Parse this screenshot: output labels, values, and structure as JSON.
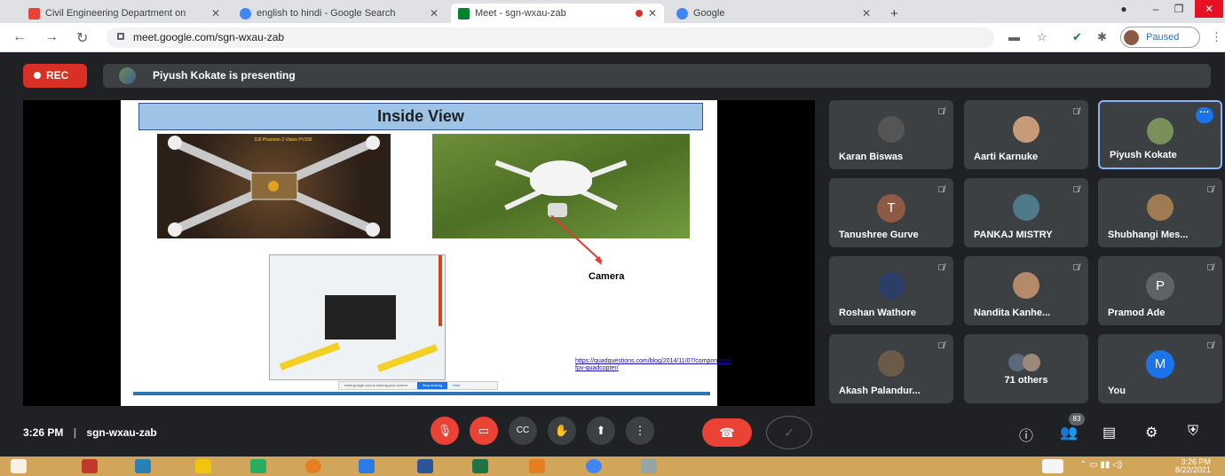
{
  "browser": {
    "tabs": [
      {
        "title": "Civil Engineering Department on",
        "favicon_color": "#ea4335"
      },
      {
        "title": "english to hindi - Google Search",
        "favicon_color": "#4285f4"
      },
      {
        "title": "Meet - sgn-wxau-zab",
        "favicon_color": "#00832d"
      },
      {
        "title": "Google",
        "favicon_color": "#4285f4"
      }
    ],
    "new_tab": "+",
    "url": "meet.google.com/sgn-wxau-zab",
    "profile_status": "Paused"
  },
  "meet": {
    "rec_label": "REC",
    "presenting_text": "Piyush Kokate is presenting",
    "slide": {
      "title": "Inside View",
      "camera_label": "Camera",
      "link": "https://quadquestions.com/blog/2014/11/07/components-fpv-quadcopter/",
      "img1_caption": "DJI Phantom 2 Vision PV330",
      "share_text": "meet.google.com is sharing your screen",
      "stop_sharing": "Stop sharing",
      "hide": "Hide"
    },
    "participants": [
      {
        "name": "Karan Biswas",
        "avatar_color": "#555"
      },
      {
        "name": "Aarti Karnuke",
        "avatar_color": "#c79a78"
      },
      {
        "name": "Piyush Kokate",
        "avatar_color": "#7a8f5a"
      },
      {
        "name": "Tanushree Gurve",
        "letter": "T",
        "avatar_color": "#8d5b45"
      },
      {
        "name": "PANKAJ MISTRY",
        "avatar_color": "#4f7a8a"
      },
      {
        "name": "Shubhangi Mes...",
        "avatar_color": "#a07a50"
      },
      {
        "name": "Roshan Wathore",
        "avatar_color": "#2b3f66"
      },
      {
        "name": "Nandita Kanhe...",
        "avatar_color": "#b48a6a"
      },
      {
        "name": "Pramod Ade",
        "letter": "P",
        "avatar_color": "#5f6368"
      },
      {
        "name": "Akash Palandur...",
        "avatar_color": "#6a5a48"
      },
      {
        "name": "71 others"
      },
      {
        "name": "You",
        "letter": "M",
        "avatar_color": "#1a73e8"
      }
    ],
    "time": "3:26 PM",
    "meeting_code": "sgn-wxau-zab",
    "people_count": "83"
  },
  "taskbar": {
    "time": "3:26 PM",
    "date": "8/22/2021"
  }
}
